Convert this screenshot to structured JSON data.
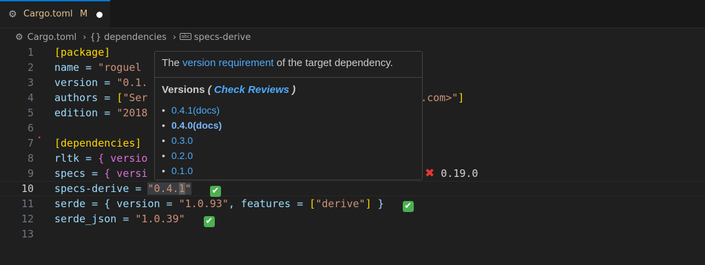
{
  "tab": {
    "title": "Cargo.toml",
    "modified": "M",
    "icon": "gear-icon"
  },
  "breadcrumb": {
    "file": "Cargo.toml",
    "section": "{} dependencies",
    "item": "specs-derive",
    "badge": "abc"
  },
  "lines": [
    {
      "n": "1"
    },
    {
      "n": "2"
    },
    {
      "n": "3"
    },
    {
      "n": "4"
    },
    {
      "n": "5"
    },
    {
      "n": "6"
    },
    {
      "n": "7"
    },
    {
      "n": "8"
    },
    {
      "n": "9"
    },
    {
      "n": "10"
    },
    {
      "n": "11"
    },
    {
      "n": "12"
    },
    {
      "n": "13"
    }
  ],
  "code": {
    "l1": "[package]",
    "l2a": "name = ",
    "l2b": "\"roguel",
    "l3a": "version = ",
    "l3b": "\"0.1.",
    "l4a": "authors = ",
    "l4b": "[",
    "l4c": "\"Ser",
    "l4d": "ail.com>\"",
    "l4e": "]",
    "l5a": "edition = ",
    "l5b": "\"2018",
    "l7": "[dependencies]",
    "l8a": "rltk = ",
    "l8b": "{ versio",
    "l9a": "specs = ",
    "l9b": "{ versi",
    "l9c": "0.19.0",
    "l10a": "specs-derive = ",
    "l10b": "\"0.4.",
    "l10c": "1",
    "l10d": "\"",
    "l11a": "serde = { version = ",
    "l11b": "\"1.0.93\"",
    "l11c": ", features = ",
    "l11d": "[",
    "l11e": "\"derive\"",
    "l11f": "]",
    "l11g": " }",
    "l12a": "serde_json = ",
    "l12b": "\"1.0.39\""
  },
  "hover": {
    "desc_prefix": "The ",
    "desc_link": "version requirement",
    "desc_suffix": " of the target dependency.",
    "versions_label": "Versions",
    "check_reviews_open": " ( ",
    "check_reviews": "Check Reviews",
    "check_reviews_close": " )",
    "versions": [
      {
        "label": "0.4.1(docs)",
        "bold": false
      },
      {
        "label": "0.4.0(docs)",
        "bold": true
      },
      {
        "label": "0.3.0",
        "bold": false
      },
      {
        "label": "0.2.0",
        "bold": false
      },
      {
        "label": "0.1.0",
        "bold": false
      }
    ]
  },
  "status": {
    "ok": "✔",
    "error": "✖"
  },
  "colors": {
    "accent": "#0078d4",
    "link": "#4daafc",
    "string": "#ce9178",
    "key": "#9cdcfe",
    "ok": "#4caf50",
    "error": "#e53935"
  }
}
